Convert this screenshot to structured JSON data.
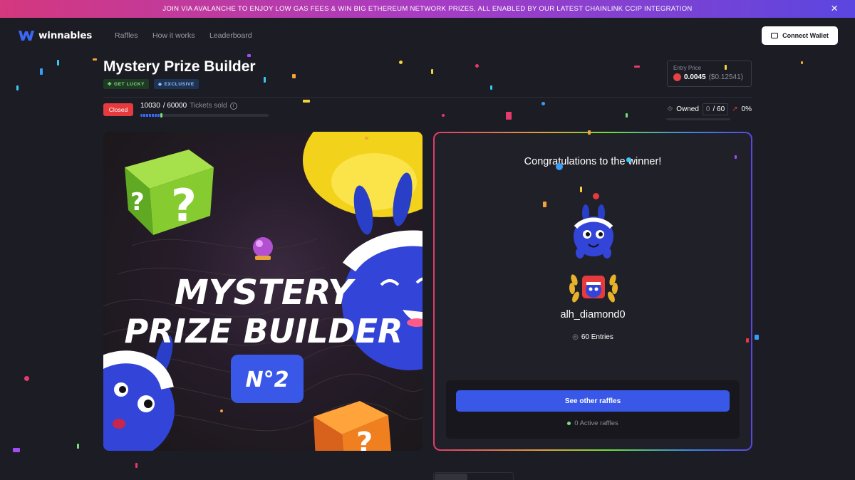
{
  "banner": {
    "text": "JOIN VIA AVALANCHE TO ENJOY LOW GAS FEES & WIN BIG ETHEREUM NETWORK PRIZES, ALL ENABLED BY OUR LATEST CHAINLINK CCIP INTEGRATION"
  },
  "nav": {
    "logo_text": "winnables",
    "links": [
      "Raffles",
      "How it works",
      "Leaderboard"
    ],
    "connect_label": "Connect Wallet"
  },
  "raffle": {
    "title": "Mystery Prize Builder",
    "tags": [
      "GET LUCKY",
      "EXCLUSIVE"
    ],
    "entry_price_label": "Entry Price",
    "entry_price": "0.0045",
    "entry_price_usd": "($0.12541)",
    "status": "Closed",
    "tickets_sold": "10030",
    "tickets_total": "/ 60000",
    "tickets_label": "Tickets sold",
    "tickets_fraction": 0.167,
    "owned_label": "Owned",
    "owned_count": "0",
    "owned_max": "/ 60",
    "owned_percent": "0%"
  },
  "hero": {
    "line1": "MYSTERY",
    "line2": "PRIZE BUILDER",
    "badge": "N°2"
  },
  "winner": {
    "heading": "Congratulations to the winner!",
    "username": "alh_diamond0",
    "entries": "60 Entries",
    "see_other_label": "See other raffles",
    "active_raffles": "0 Active raffles"
  },
  "colors": {
    "accent": "#3a58e8",
    "closed": "#e53a3e",
    "success": "#7be07a"
  }
}
